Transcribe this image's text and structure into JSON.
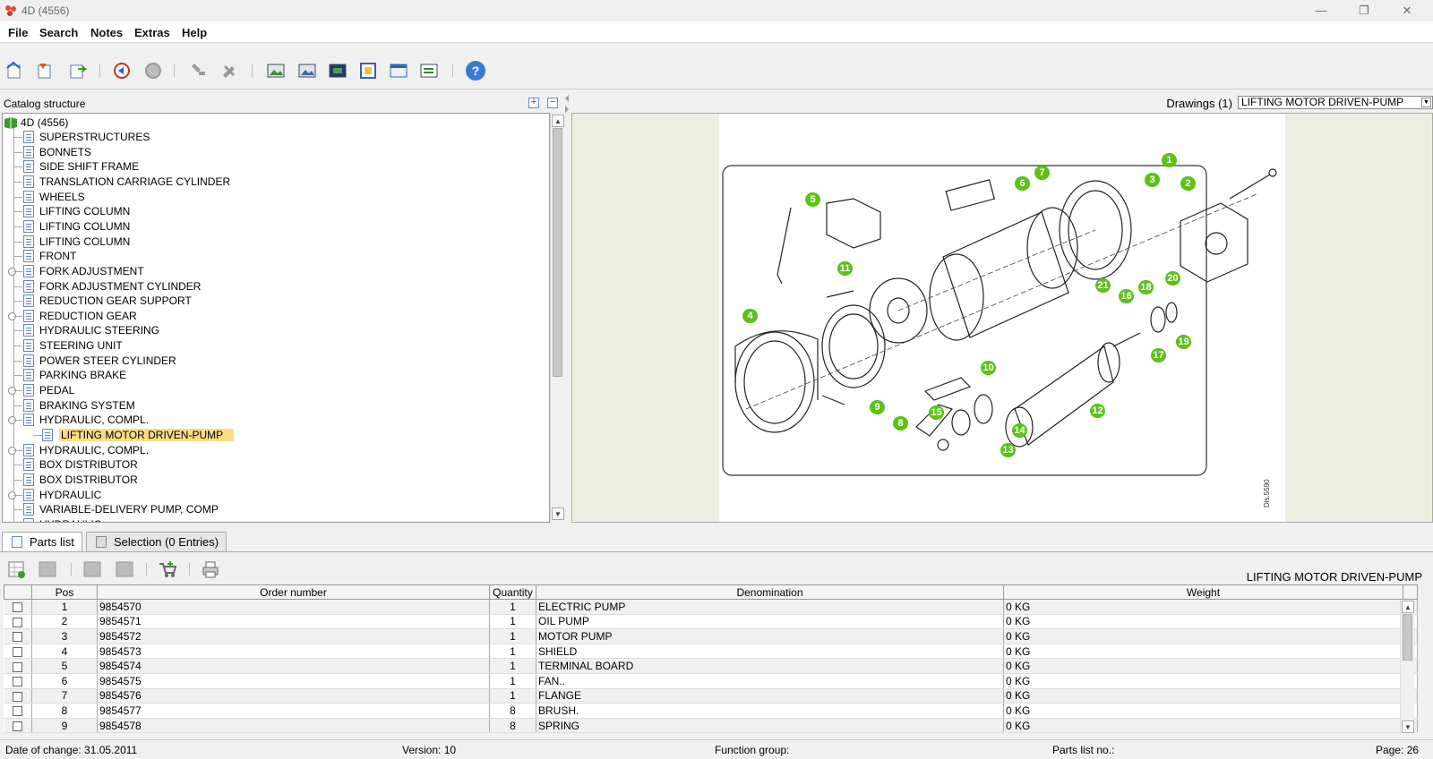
{
  "window": {
    "title": "4D (4556)",
    "minimize": "—",
    "restore": "❐",
    "close": "✕"
  },
  "menu": [
    "File",
    "Search",
    "Notes",
    "Extras",
    "Help"
  ],
  "toolbar": {
    "help_glyph": "?"
  },
  "catalog": {
    "header": "Catalog structure",
    "expand_glyph": "+",
    "collapse_glyph": "−",
    "root": "4D (4556)",
    "items": [
      {
        "label": "SUPERSTRUCTURES",
        "expandable": false
      },
      {
        "label": "BONNETS",
        "expandable": false
      },
      {
        "label": "SIDE SHIFT FRAME",
        "expandable": false
      },
      {
        "label": "TRANSLATION CARRIAGE CYLINDER",
        "expandable": false
      },
      {
        "label": "WHEELS",
        "expandable": false
      },
      {
        "label": "LIFTING COLUMN",
        "expandable": false
      },
      {
        "label": "LIFTING COLUMN",
        "expandable": false
      },
      {
        "label": "LIFTING COLUMN",
        "expandable": false
      },
      {
        "label": "FRONT",
        "expandable": false
      },
      {
        "label": "FORK ADJUSTMENT",
        "expandable": true
      },
      {
        "label": "FORK ADJUSTMENT CYLINDER",
        "expandable": false
      },
      {
        "label": "REDUCTION GEAR SUPPORT",
        "expandable": false
      },
      {
        "label": "REDUCTION GEAR",
        "expandable": true
      },
      {
        "label": "HYDRAULIC STEERING",
        "expandable": false
      },
      {
        "label": "STEERING UNIT",
        "expandable": false
      },
      {
        "label": "POWER STEER CYLINDER",
        "expandable": false
      },
      {
        "label": "PARKING BRAKE",
        "expandable": false
      },
      {
        "label": "PEDAL",
        "expandable": true
      },
      {
        "label": "BRAKING SYSTEM",
        "expandable": false
      },
      {
        "label": "HYDRAULIC, COMPL.",
        "expandable": true
      },
      {
        "label": "LIFTING MOTOR DRIVEN-PUMP",
        "expandable": false,
        "selected": true
      },
      {
        "label": "HYDRAULIC, COMPL.",
        "expandable": true
      },
      {
        "label": "BOX DISTRIBUTOR",
        "expandable": false
      },
      {
        "label": "BOX DISTRIBUTOR",
        "expandable": false
      },
      {
        "label": "HYDRAULIC",
        "expandable": true
      },
      {
        "label": "VARIABLE-DELIVERY PUMP, COMP",
        "expandable": false
      },
      {
        "label": "HYDRAULIC",
        "expandable": false
      }
    ]
  },
  "drawings": {
    "label": "Drawings (1)",
    "selected": "LIFTING MOTOR DRIVEN-PUMP",
    "side_text": "Dis.5590",
    "callouts": [
      "1",
      "2",
      "3",
      "4",
      "5",
      "6",
      "7",
      "8",
      "9",
      "10",
      "11",
      "12",
      "13",
      "14",
      "15",
      "16",
      "17",
      "18",
      "19",
      "20",
      "21"
    ]
  },
  "tabs": [
    {
      "label": "Parts list",
      "active": true
    },
    {
      "label": "Selection (0 Entries)",
      "active": false
    }
  ],
  "parts": {
    "title": "LIFTING MOTOR DRIVEN-PUMP",
    "columns": [
      "",
      "Pos",
      "Order number",
      "Quantity",
      "Denomination",
      "Weight"
    ],
    "rows": [
      [
        "1",
        "9854570",
        "1",
        "ELECTRIC PUMP",
        "0 KG"
      ],
      [
        "2",
        "9854571",
        "1",
        "OIL PUMP",
        "0 KG"
      ],
      [
        "3",
        "9854572",
        "1",
        "MOTOR PUMP",
        "0 KG"
      ],
      [
        "4",
        "9854573",
        "1",
        "SHIELD",
        "0 KG"
      ],
      [
        "5",
        "9854574",
        "1",
        "TERMINAL BOARD",
        "0 KG"
      ],
      [
        "6",
        "9854575",
        "1",
        "FAN..",
        "0 KG"
      ],
      [
        "7",
        "9854576",
        "1",
        "FLANGE",
        "0 KG"
      ],
      [
        "8",
        "9854577",
        "8",
        "BRUSH.",
        "0 KG"
      ],
      [
        "9",
        "9854578",
        "8",
        "SPRING",
        "0 KG"
      ]
    ]
  },
  "status": {
    "date": "Date of change: 31.05.2011",
    "version": "Version: 10",
    "function_group": "Function group:",
    "parts_list_no": "Parts list no.:",
    "page": "Page: 26"
  },
  "colors": {
    "callout": "#5cc21a",
    "selection": "#fcdc84",
    "drawing_bg": "#eceee0"
  }
}
